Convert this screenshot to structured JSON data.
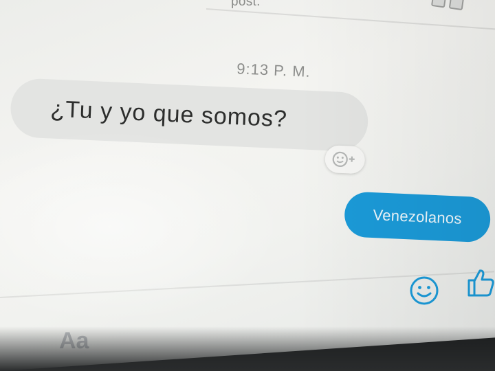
{
  "header": {
    "post_link": "post."
  },
  "conversation": {
    "timestamp": "9:13 P. M.",
    "incoming_message": "¿Tu y yo que somos?",
    "outgoing_message": "Venezolanos"
  },
  "composer": {
    "placeholder": "Aa"
  },
  "colors": {
    "outgoing_bubble": "#1b9ad8",
    "incoming_bubble": "#e3e4e2",
    "icon_blue": "#1b9ad8"
  },
  "icons": {
    "react": "smiley-add-icon",
    "emoji": "smiley-icon",
    "like": "thumbs-up-icon"
  }
}
